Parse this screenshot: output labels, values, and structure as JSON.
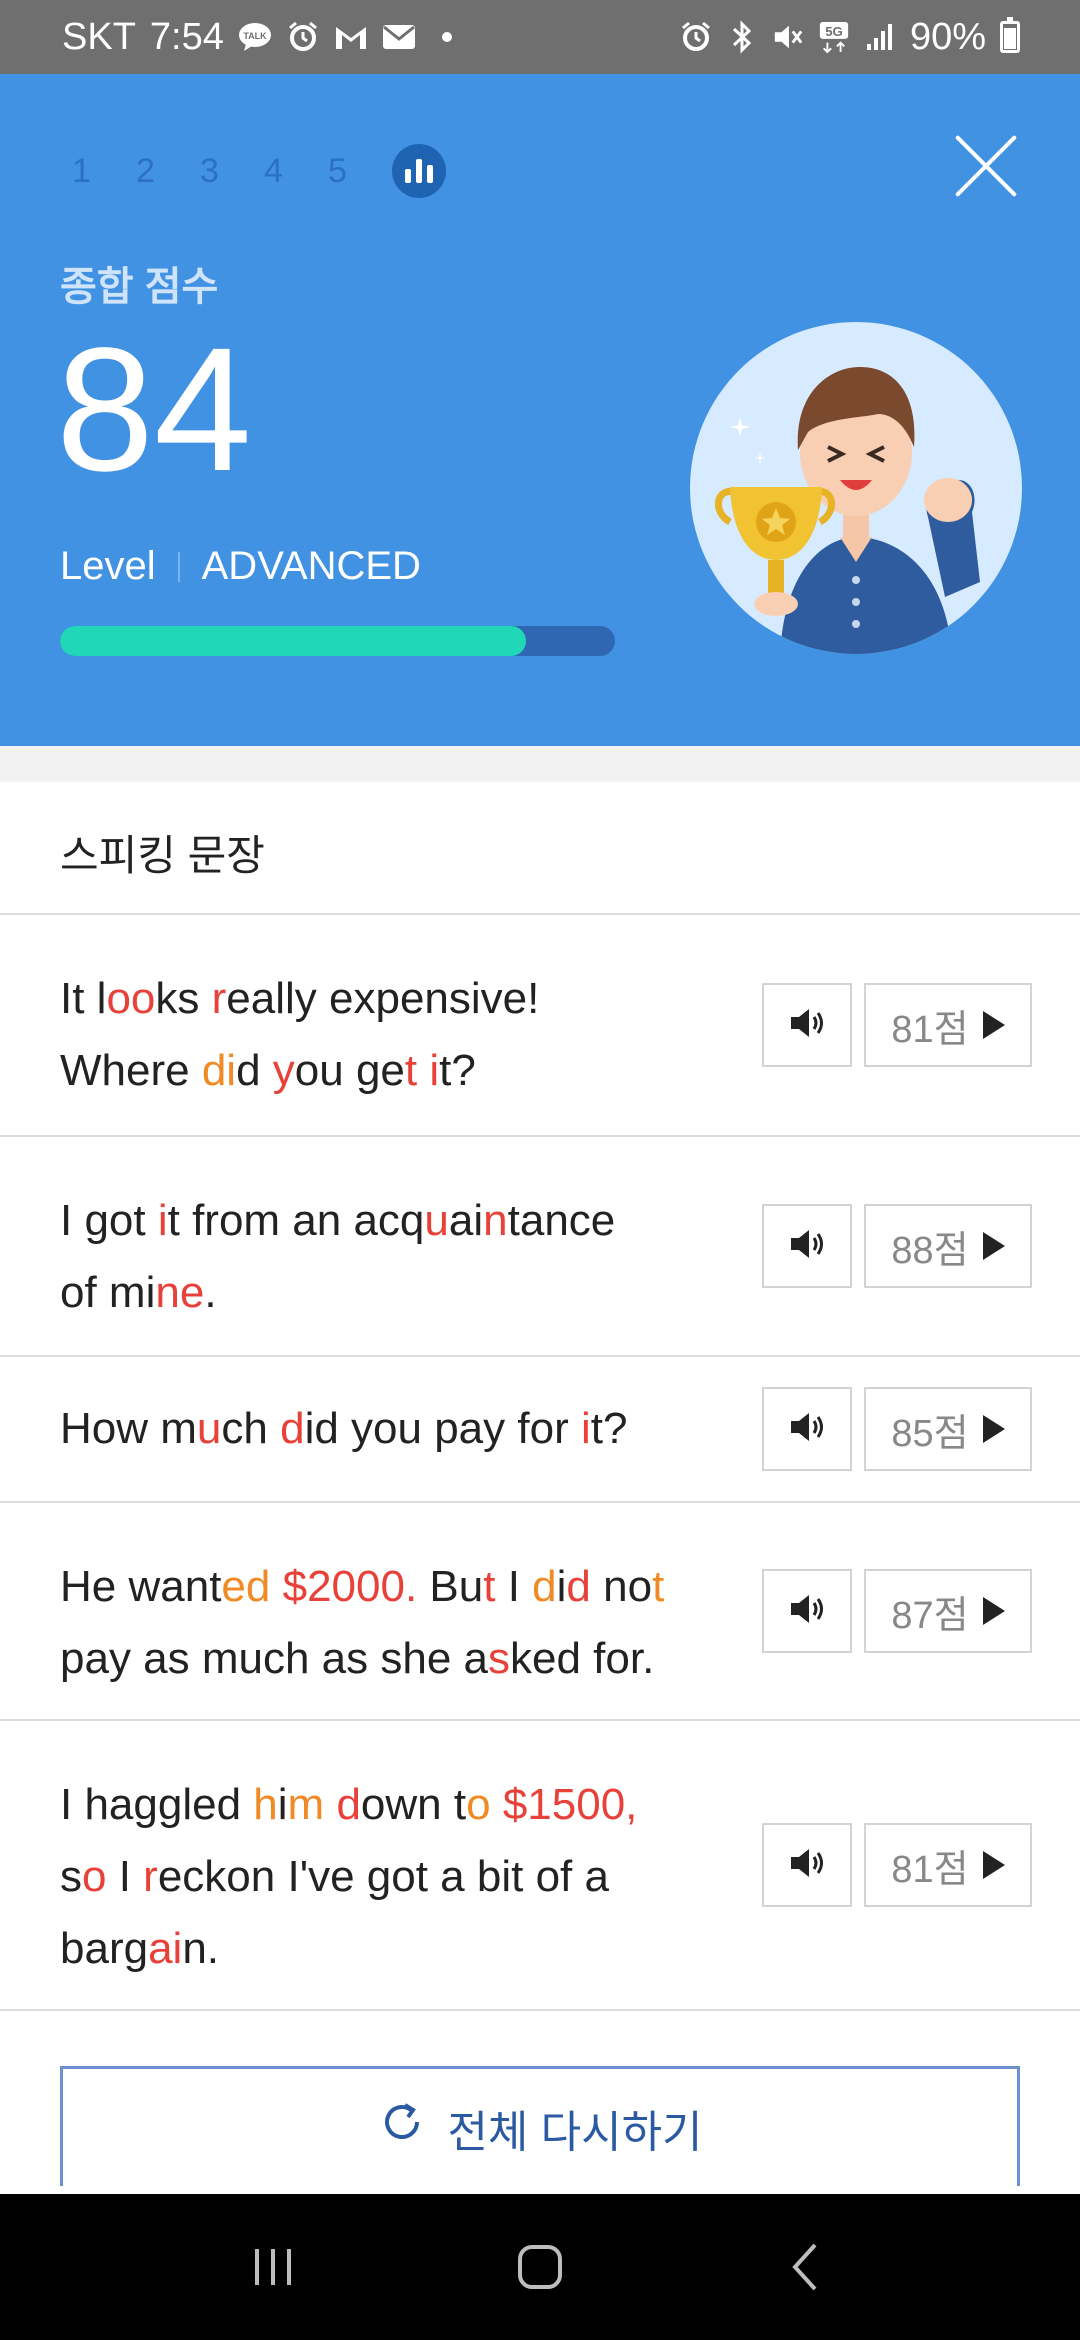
{
  "status_bar": {
    "carrier": "SKT",
    "time": "7:54",
    "battery": "90%",
    "network": "5G",
    "icons_left": [
      "talk-icon",
      "alarm-icon",
      "gmail-icon",
      "mail-icon",
      "dot-icon"
    ],
    "icons_right": [
      "alarm-icon",
      "bluetooth-icon",
      "mute-icon",
      "5g-icon",
      "signal-icon",
      "battery-icon"
    ]
  },
  "header": {
    "steps": [
      "1",
      "2",
      "3",
      "4",
      "5"
    ],
    "active_step_icon": "bar-chart-icon",
    "score_label": "종합 점수",
    "score": "84",
    "level_label": "Level",
    "level_value": "ADVANCED",
    "progress_fraction": 0.84,
    "colors": {
      "background": "#4292e4",
      "progress_fill": "#20d8b8",
      "progress_track": "#2f67b3"
    }
  },
  "section": {
    "title": "스피킹 문장"
  },
  "sentences": [
    {
      "score": "81점",
      "lines": [
        [
          [
            "It l",
            ""
          ],
          [
            "oo",
            "r"
          ],
          [
            "ks ",
            ""
          ],
          [
            "r",
            "r"
          ],
          [
            "eally expensive!",
            ""
          ]
        ],
        [
          [
            "Where ",
            ""
          ],
          [
            "di",
            "o"
          ],
          [
            "d ",
            ""
          ],
          [
            "y",
            "r"
          ],
          [
            "ou ge",
            ""
          ],
          [
            "t",
            "r"
          ],
          [
            " ",
            ""
          ],
          [
            "i",
            "r"
          ],
          [
            "t?",
            ""
          ]
        ]
      ]
    },
    {
      "score": "88점",
      "lines": [
        [
          [
            "I got ",
            ""
          ],
          [
            "i",
            "r"
          ],
          [
            "t from an acq",
            ""
          ],
          [
            "u",
            "r"
          ],
          [
            "ai",
            ""
          ],
          [
            "n",
            "r"
          ],
          [
            "tance",
            ""
          ]
        ],
        [
          [
            "of mi",
            ""
          ],
          [
            "ne",
            "r"
          ],
          [
            ".",
            ""
          ]
        ]
      ]
    },
    {
      "score": "85점",
      "lines": [
        [
          [
            "How m",
            ""
          ],
          [
            "u",
            "r"
          ],
          [
            "ch ",
            ""
          ],
          [
            "d",
            "r"
          ],
          [
            "id you pay for ",
            ""
          ],
          [
            "i",
            "r"
          ],
          [
            "t?",
            ""
          ]
        ]
      ]
    },
    {
      "score": "87점",
      "lines": [
        [
          [
            "He want",
            ""
          ],
          [
            "ed",
            "o"
          ],
          [
            " ",
            ""
          ],
          [
            "$2000.",
            "r"
          ],
          [
            " Bu",
            ""
          ],
          [
            "t",
            "r"
          ],
          [
            " I ",
            ""
          ],
          [
            "d",
            "o"
          ],
          [
            "i",
            ""
          ],
          [
            "d",
            "r"
          ],
          [
            " no",
            ""
          ],
          [
            "t",
            "o"
          ]
        ],
        [
          [
            "pay as much as she a",
            ""
          ],
          [
            "s",
            "r"
          ],
          [
            "ked for.",
            ""
          ]
        ]
      ]
    },
    {
      "score": "81점",
      "lines": [
        [
          [
            "I haggled ",
            ""
          ],
          [
            "h",
            "o"
          ],
          [
            "i",
            ""
          ],
          [
            "m",
            "o"
          ],
          [
            " ",
            ""
          ],
          [
            "d",
            "r"
          ],
          [
            "own t",
            ""
          ],
          [
            "o",
            "o"
          ],
          [
            " ",
            ""
          ],
          [
            "$1500,",
            "r"
          ]
        ],
        [
          [
            "s",
            ""
          ],
          [
            "o",
            "r"
          ],
          [
            " I ",
            ""
          ],
          [
            "r",
            "r"
          ],
          [
            "eckon I've got a bit of a",
            ""
          ]
        ],
        [
          [
            "barg",
            ""
          ],
          [
            "ai",
            "r"
          ],
          [
            "n.",
            ""
          ]
        ]
      ]
    }
  ],
  "retry_button": {
    "label": "전체 다시하기",
    "icon": "refresh-icon"
  },
  "nav": {
    "icons": [
      "recent-apps-icon",
      "home-icon",
      "back-icon"
    ]
  }
}
